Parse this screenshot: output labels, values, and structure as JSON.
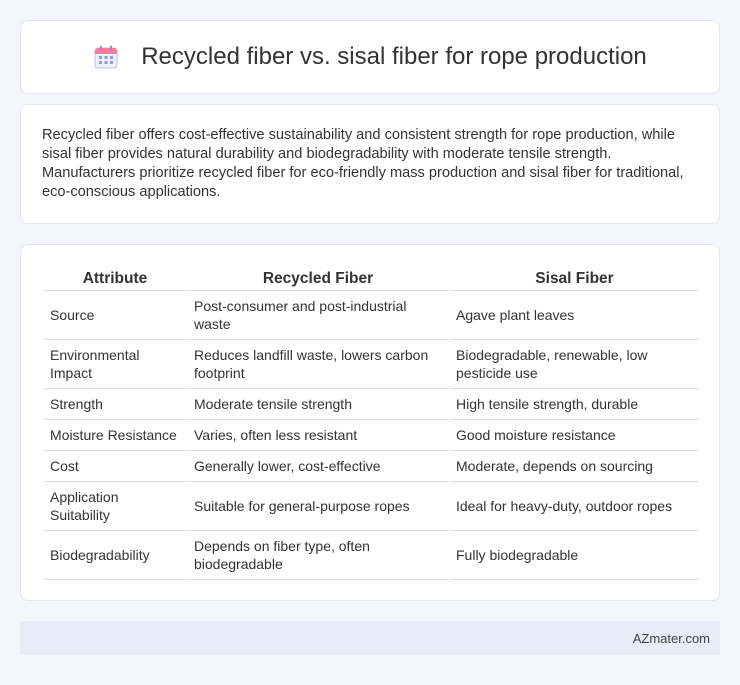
{
  "header": {
    "title": "Recycled fiber vs. sisal fiber for rope production",
    "icon": "calendar-icon",
    "icon_color": "#6d7fd8"
  },
  "summary": {
    "text": "Recycled fiber offers cost-effective sustainability and consistent strength for rope production, while sisal fiber provides natural durability and biodegradability with moderate tensile strength. Manufacturers prioritize recycled fiber for eco-friendly mass production and sisal fiber for traditional, eco-conscious applications."
  },
  "table": {
    "headers": [
      "Attribute",
      "Recycled Fiber",
      "Sisal Fiber"
    ],
    "rows": [
      [
        "Source",
        "Post-consumer and post-industrial waste",
        "Agave plant leaves"
      ],
      [
        "Environmental Impact",
        "Reduces landfill waste, lowers carbon footprint",
        "Biodegradable, renewable, low pesticide use"
      ],
      [
        "Strength",
        "Moderate tensile strength",
        "High tensile strength, durable"
      ],
      [
        "Moisture Resistance",
        "Varies, often less resistant",
        "Good moisture resistance"
      ],
      [
        "Cost",
        "Generally lower, cost-effective",
        "Moderate, depends on sourcing"
      ],
      [
        "Application Suitability",
        "Suitable for general-purpose ropes",
        "Ideal for heavy-duty, outdoor ropes"
      ],
      [
        "Biodegradability",
        "Depends on fiber type, often biodegradable",
        "Fully biodegradable"
      ]
    ]
  },
  "footer": {
    "brand": "AZmater.com"
  }
}
